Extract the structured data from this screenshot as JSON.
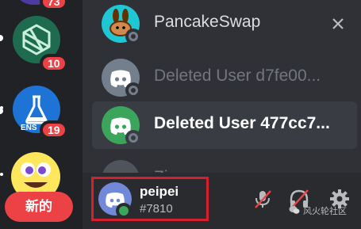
{
  "servers": [
    {
      "name": "server-top-partial",
      "badge": "73"
    },
    {
      "name": "server-hexagon",
      "badge": "10"
    },
    {
      "name": "server-ens",
      "badge": "19",
      "label": "ENS"
    },
    {
      "name": "server-emoji",
      "badge": ""
    }
  ],
  "new_label": "新的",
  "dms": [
    {
      "name": "PancakeSwap",
      "style": "normal"
    },
    {
      "name": "Deleted User d7fe00...",
      "style": "muted"
    },
    {
      "name": "Deleted User 477cc7...",
      "style": "bold"
    },
    {
      "name": "Zi",
      "style": "muted"
    }
  ],
  "user": {
    "name": "peipei",
    "tag": "#7810",
    "status": "online"
  },
  "controls": [
    "mute-icon",
    "deafen-icon",
    "settings-icon"
  ],
  "watermark": "风火轮社区",
  "colors": {
    "blurple": "#7289da",
    "green": "#3ba55c",
    "red": "#ed4245",
    "yellow": "#fee75c",
    "highlight": "#d61f2d"
  }
}
